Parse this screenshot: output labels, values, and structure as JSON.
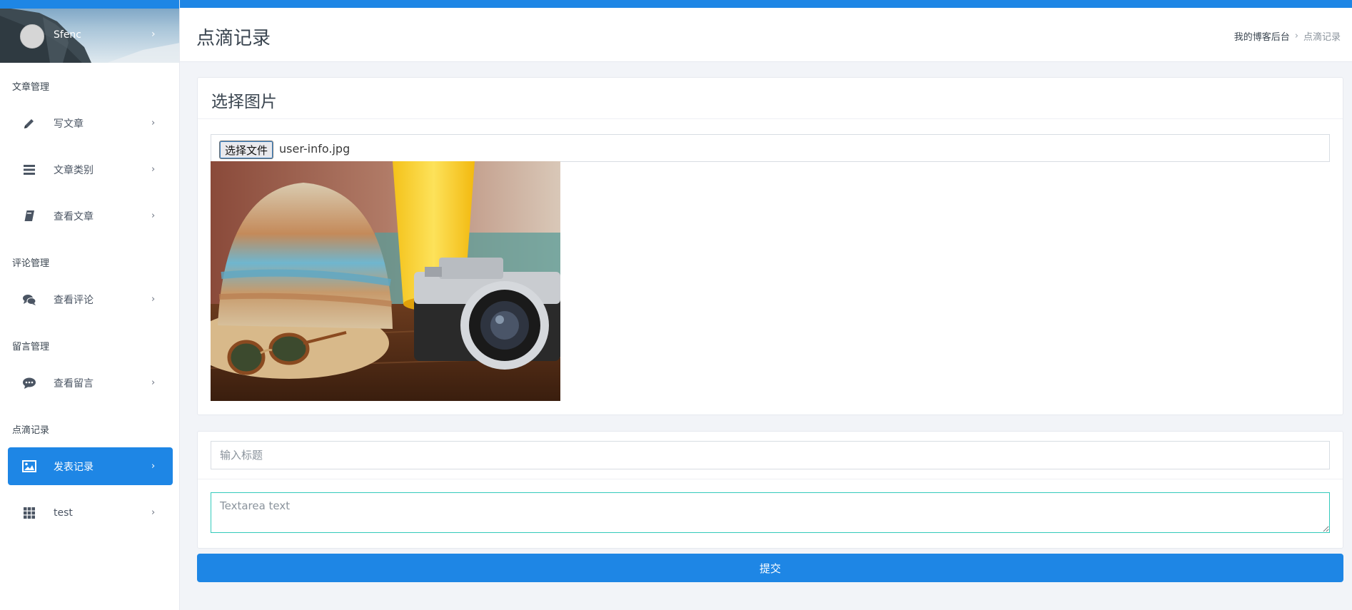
{
  "colors": {
    "accent": "#1e86e5",
    "textarea_focus": "#33cabb"
  },
  "profile": {
    "name": "Sfenc",
    "chevron": "›"
  },
  "sidebar": {
    "groups": [
      {
        "label": "文章管理"
      },
      {
        "label": "评论管理"
      },
      {
        "label": "留言管理"
      },
      {
        "label": "点滴记录"
      }
    ],
    "items": [
      {
        "label": "写文章",
        "icon": "pencil-icon",
        "chevron": "›"
      },
      {
        "label": "文章类别",
        "icon": "list-icon",
        "chevron": "›"
      },
      {
        "label": "查看文章",
        "icon": "book-icon",
        "chevron": "›"
      },
      {
        "label": "查看评论",
        "icon": "comments-icon",
        "chevron": "›"
      },
      {
        "label": "查看留言",
        "icon": "chat-bubble-icon",
        "chevron": "›"
      },
      {
        "label": "发表记录",
        "icon": "image-icon",
        "chevron": "›",
        "active": true
      },
      {
        "label": "test",
        "icon": "grid-icon",
        "chevron": "›"
      }
    ]
  },
  "header": {
    "title": "点滴记录",
    "breadcrumb": {
      "home": "我的博客后台",
      "separator": "›",
      "current": "点滴记录"
    }
  },
  "upload": {
    "title": "选择图片",
    "file_button": "选择文件",
    "file_name": "user-info.jpg"
  },
  "form": {
    "title_placeholder": "输入标题",
    "textarea_placeholder": "Textarea text",
    "submit_label": "提交"
  }
}
